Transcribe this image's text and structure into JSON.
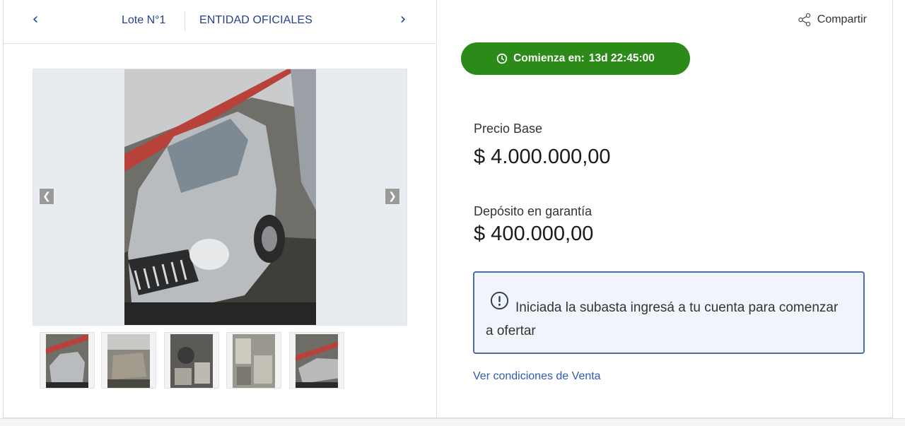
{
  "lot_nav": {
    "lot_label": "Lote N°1",
    "entity_label": "ENTIDAD OFICIALES",
    "prev_icon": "chevron-left-icon",
    "next_icon": "chevron-right-icon"
  },
  "gallery": {
    "prev_icon": "gallery-prev-icon",
    "next_icon": "gallery-next-icon",
    "thumbnail_count": 5
  },
  "share": {
    "label": "Compartir",
    "icon": "share-icon"
  },
  "countdown": {
    "prefix": "Comienza en:",
    "value": "13d 22:45:00",
    "icon": "clock-icon",
    "color": "#2b8a18"
  },
  "pricing": {
    "base_label": "Precio Base",
    "base_value": "$ 4.000.000,00",
    "deposit_label": "Depósito en garantía",
    "deposit_value": "$ 400.000,00"
  },
  "notice": {
    "icon": "info-icon",
    "text": "Iniciada la subasta ingresá a tu cuenta para comenzar a ofertar"
  },
  "links": {
    "conditions": "Ver condiciones de Venta"
  },
  "colors": {
    "accent_blue": "#24418f",
    "link_blue": "#2c5bb8",
    "notice_border": "#4a6fa8"
  }
}
